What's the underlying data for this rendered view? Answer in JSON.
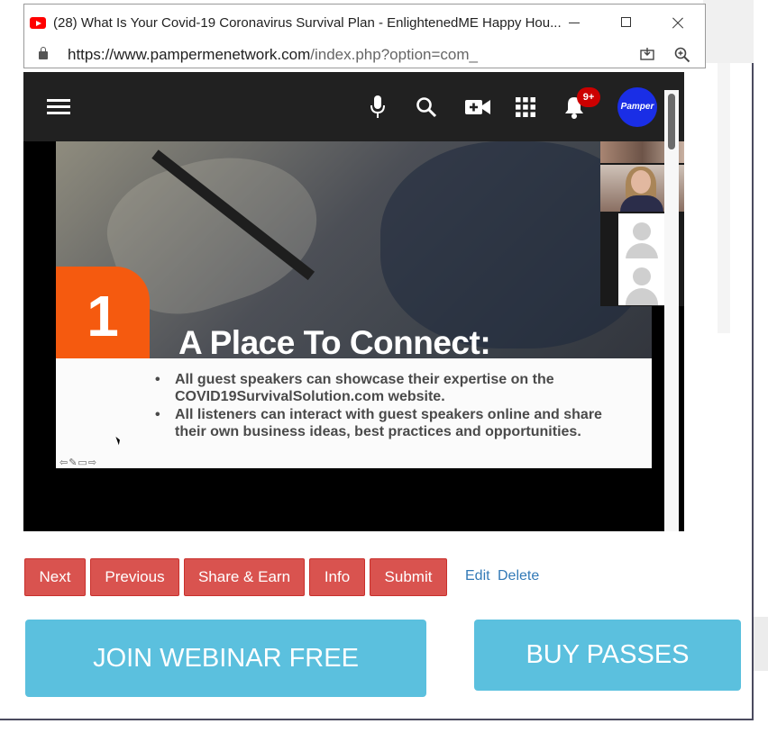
{
  "window": {
    "title": "(28) What Is Your Covid-19 Coronavirus Survival Plan - EnlightenedME Happy Hou...",
    "url_host": "https://www.pampermenetwork.com",
    "url_path": "/index.php?option=com_"
  },
  "header": {
    "notification_count": "9+",
    "avatar_label": "Pamper"
  },
  "slide": {
    "number": "1",
    "title": "A Place To Connect:",
    "bullets": [
      "All guest speakers can showcase their expertise on the COVID19SurvivalSolution.com website.",
      "All listeners can interact with guest speakers online and share their own business ideas, best practices and opportunities."
    ],
    "nav_controls": "⇦✎▭⇨"
  },
  "actions": {
    "next": "Next",
    "previous": "Previous",
    "share": "Share & Earn",
    "info": "Info",
    "submit": "Submit",
    "edit": "Edit",
    "delete": "Delete"
  },
  "cta": {
    "join": "JOIN WEBINAR FREE",
    "buy": "BUY PASSES"
  },
  "colors": {
    "danger_button": "#d9534f",
    "info_button": "#5bc0de",
    "link": "#337ab7",
    "slide_accent": "#f55a0f",
    "header_bg": "#212121",
    "avatar_bg": "#1a2ee6"
  },
  "icons": [
    "youtube-icon",
    "minimize-icon",
    "maximize-icon",
    "close-icon",
    "lock-icon",
    "install-icon",
    "zoom-icon",
    "menu-icon",
    "mic-icon",
    "search-icon",
    "video-add-icon",
    "apps-icon",
    "bell-icon"
  ]
}
